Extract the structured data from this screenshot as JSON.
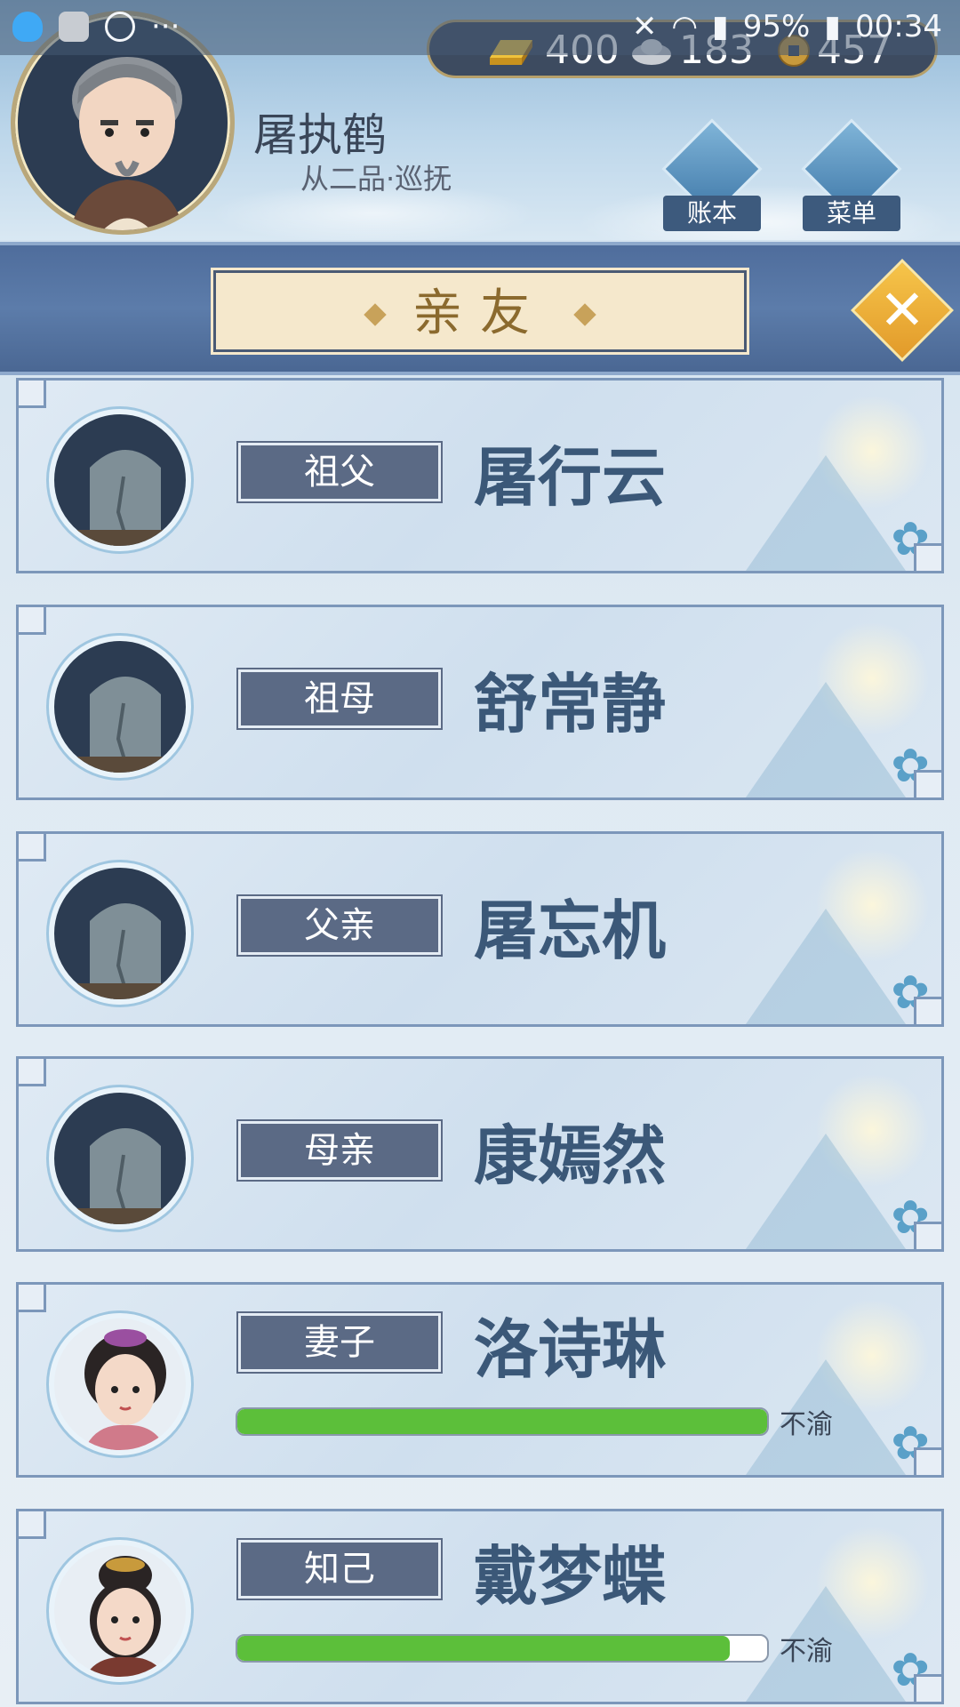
{
  "status_bar": {
    "battery": "95%",
    "time": "00:34"
  },
  "player": {
    "name": "屠执鹤",
    "rank": "从二品·巡抚"
  },
  "currency": {
    "gold": "400",
    "silver": "183",
    "coins": "457"
  },
  "buttons": {
    "ledger": "账本",
    "menu": "菜单"
  },
  "banner": {
    "title": "亲友"
  },
  "relatives": [
    {
      "relation": "祖父",
      "name": "屠行云",
      "deceased": true
    },
    {
      "relation": "祖母",
      "name": "舒常静",
      "deceased": true
    },
    {
      "relation": "父亲",
      "name": "屠忘机",
      "deceased": true
    },
    {
      "relation": "母亲",
      "name": "康嫣然",
      "deceased": true
    },
    {
      "relation": "妻子",
      "name": "洛诗琳",
      "mood": "不渝",
      "affection": 1.0
    },
    {
      "relation": "知己",
      "name": "戴梦蝶",
      "mood": "不渝",
      "affection": 0.93
    }
  ],
  "colors": {
    "bar_fill": "#5cbf3a",
    "banner_bg": "#5c7caa",
    "tag_bg": "#5b6a85",
    "name_text": "#3b5878"
  }
}
